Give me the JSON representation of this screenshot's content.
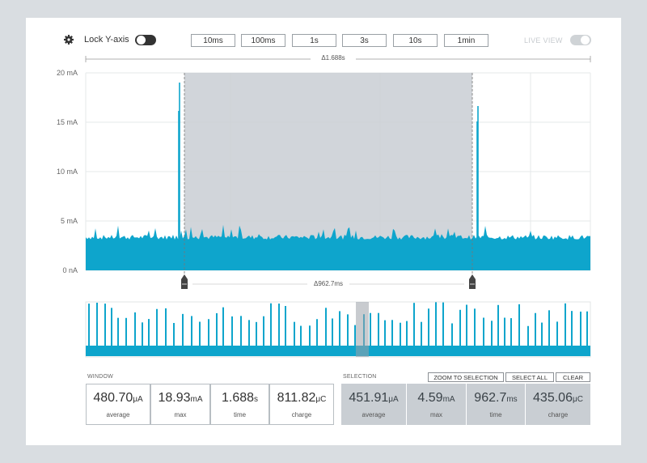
{
  "toolbar": {
    "lock_label": "Lock Y-axis",
    "time_buttons": [
      "10ms",
      "100ms",
      "1s",
      "3s",
      "10s",
      "1min"
    ],
    "live_label": "LIVE VIEW"
  },
  "chart": {
    "window_delta": "Δ1.688s",
    "selection_delta": "Δ962.7ms",
    "y_ticks": [
      "20 mA",
      "15 mA",
      "10 mA",
      "5 mA",
      "0 nA"
    ],
    "series_color": "#0ea5cc",
    "selection_fill": "#c9ced3"
  },
  "window": {
    "section_label": "WINDOW",
    "stats": [
      {
        "value": "480.70",
        "unit": "μA",
        "caption": "average"
      },
      {
        "value": "18.93",
        "unit": "mA",
        "caption": "max"
      },
      {
        "value": "1.688",
        "unit": "s",
        "caption": "time"
      },
      {
        "value": "811.82",
        "unit": "μC",
        "caption": "charge"
      }
    ]
  },
  "selection": {
    "section_label": "SELECTION",
    "buttons": [
      "ZOOM TO SELECTION",
      "SELECT ALL",
      "CLEAR"
    ],
    "stats": [
      {
        "value": "451.91",
        "unit": "μA",
        "caption": "average"
      },
      {
        "value": "4.59",
        "unit": "mA",
        "caption": "max"
      },
      {
        "value": "962.7",
        "unit": "ms",
        "caption": "time"
      },
      {
        "value": "435.06",
        "unit": "μC",
        "caption": "charge"
      }
    ]
  }
}
